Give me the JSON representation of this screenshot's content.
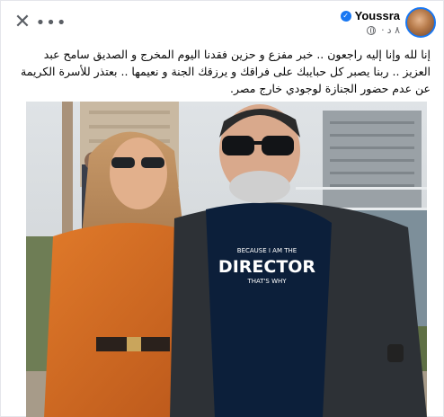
{
  "header": {
    "close_glyph": "✕",
    "more_glyph": "•••"
  },
  "author": {
    "name": "Youssra",
    "verified": true,
    "time": "٨ د",
    "privacy_icon": "globe-icon"
  },
  "post": {
    "text": "إنا لله وإنا إليه راجعون .. خبر مفزع و حزين فقدنا اليوم المخرج و الصديق سامح عبد العزيز .. ربنا يصبر كل حبايبك على فراقك و يرزقك الجنة و نعيمها .. بعتذر للأسرة الكريمة عن عدم حضور الجنازة لوجودي خارج مصر."
  },
  "photo": {
    "shirt_text_top": "BECAUSE I AM THE",
    "shirt_text_main": "DIRECTOR",
    "shirt_text_bottom": "THAT'S WHY"
  },
  "colors": {
    "accent": "#1877f2",
    "text": "#050505",
    "secondary_text": "#65676b"
  }
}
